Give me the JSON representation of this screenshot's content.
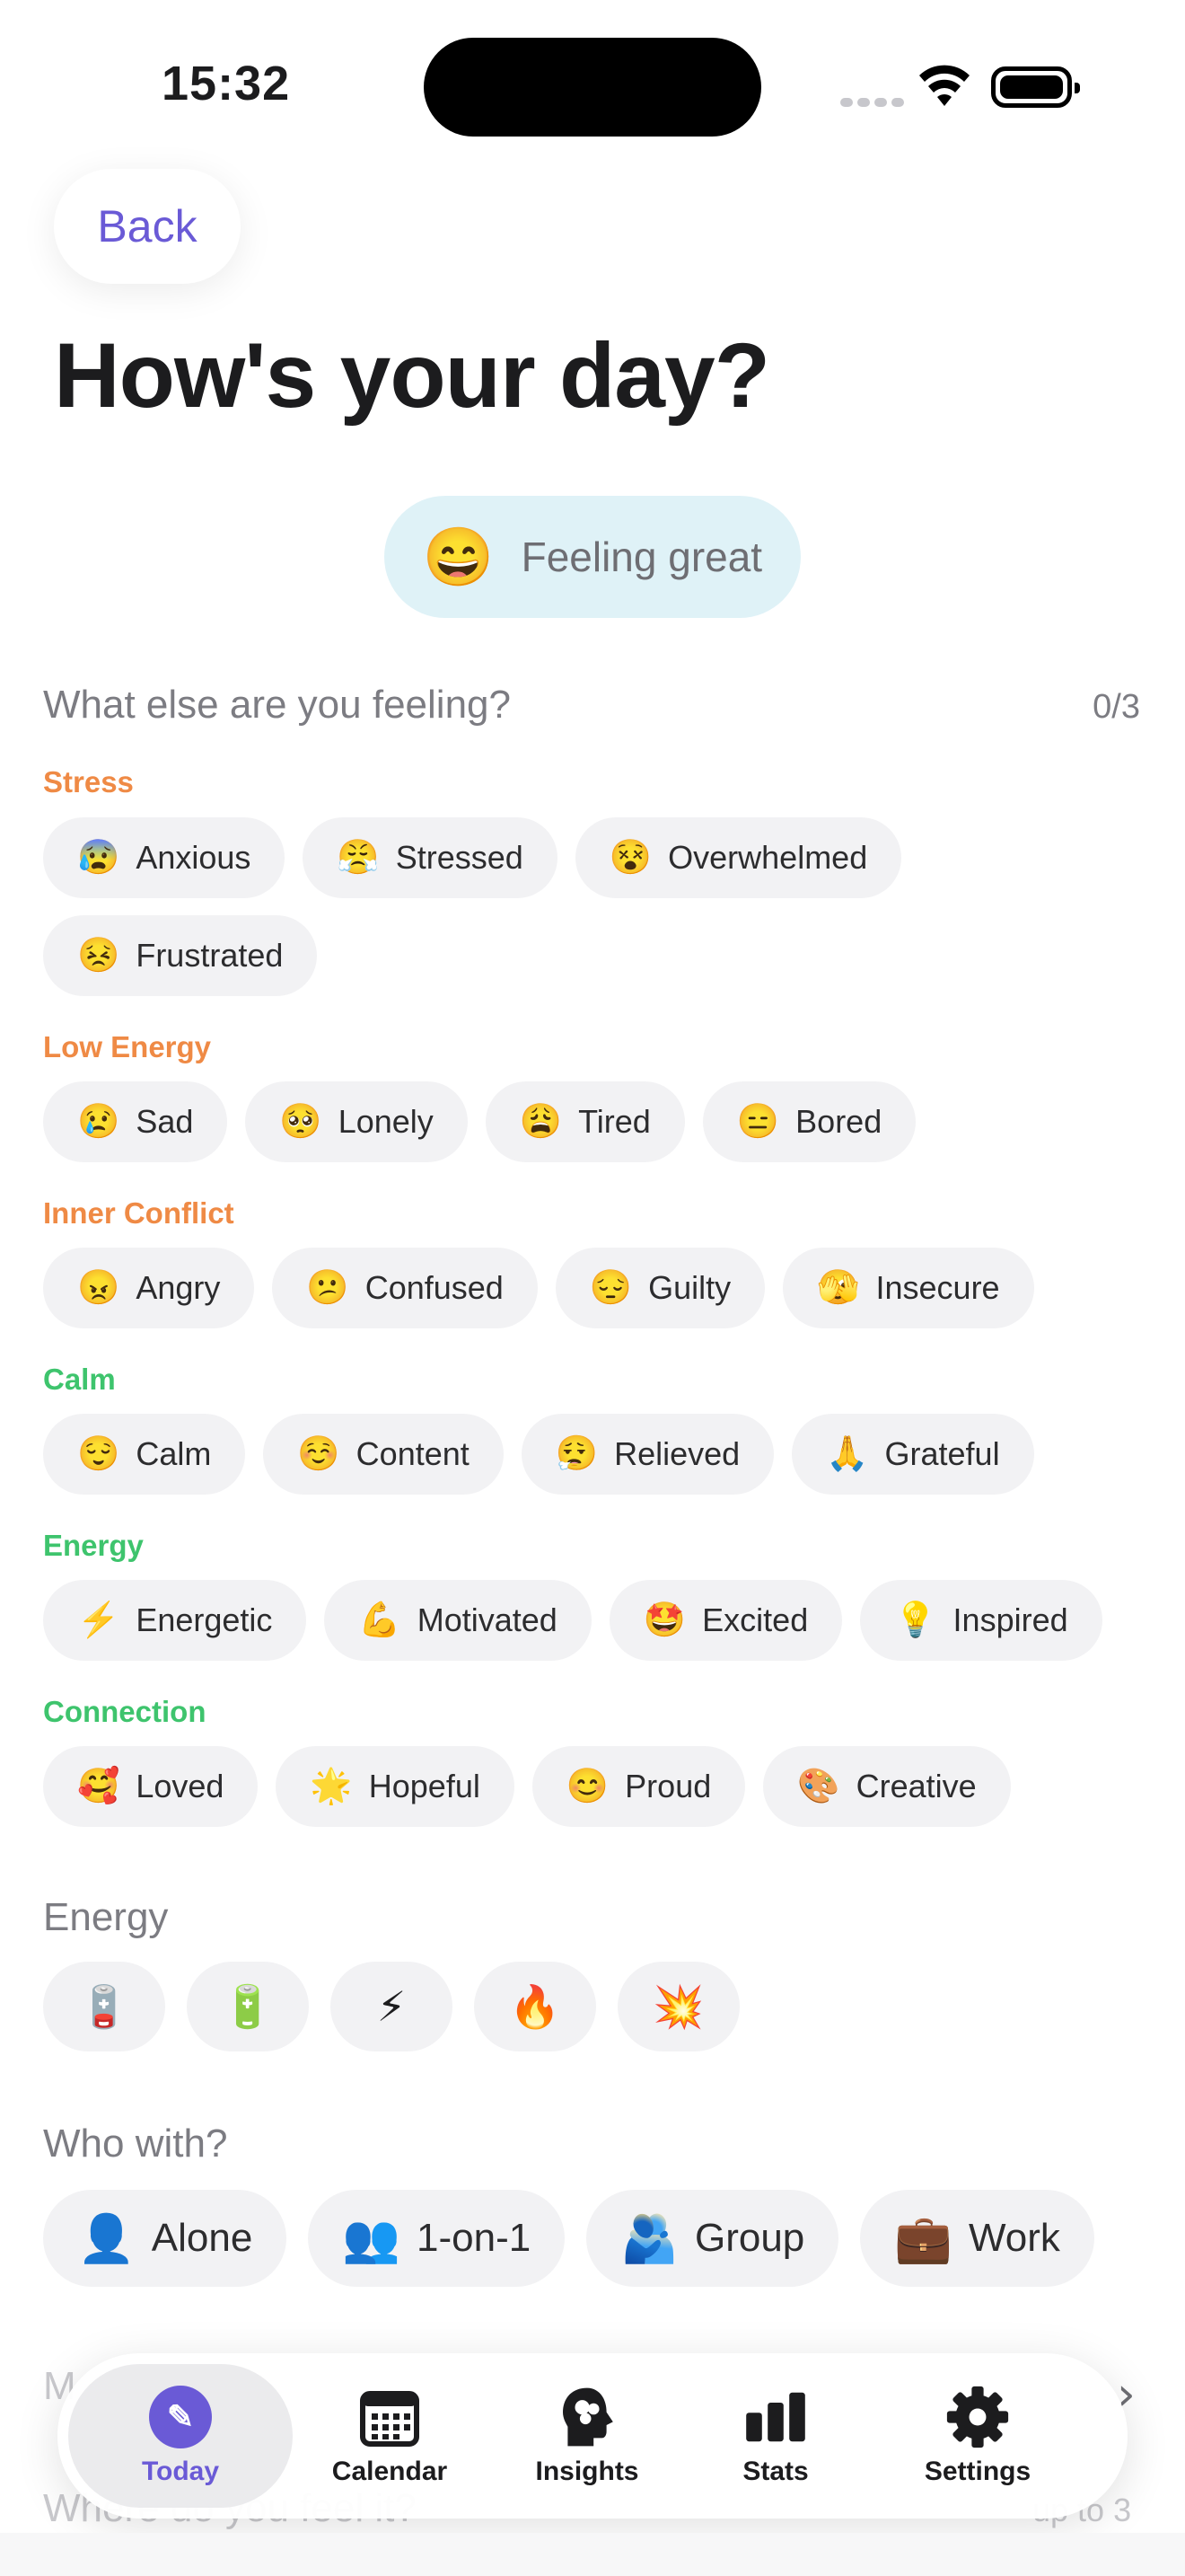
{
  "status_bar": {
    "time": "15:32"
  },
  "header": {
    "back_label": "Back",
    "title": "How's your day?"
  },
  "mood": {
    "emoji": "😄",
    "label": "Feeling great"
  },
  "feelings": {
    "question": "What else are you feeling?",
    "counter": "0/3",
    "groups": [
      {
        "title": "Stress",
        "color": "#ef8a45",
        "items": [
          {
            "emoji": "😰",
            "label": "Anxious"
          },
          {
            "emoji": "😤",
            "label": "Stressed"
          },
          {
            "emoji": "😵",
            "label": "Overwhelmed"
          },
          {
            "emoji": "😣",
            "label": "Frustrated"
          }
        ]
      },
      {
        "title": "Low Energy",
        "color": "#ef8a45",
        "items": [
          {
            "emoji": "😢",
            "label": "Sad"
          },
          {
            "emoji": "🥺",
            "label": "Lonely"
          },
          {
            "emoji": "😩",
            "label": "Tired"
          },
          {
            "emoji": "😑",
            "label": "Bored"
          }
        ]
      },
      {
        "title": "Inner Conflict",
        "color": "#ef8a45",
        "items": [
          {
            "emoji": "😠",
            "label": "Angry"
          },
          {
            "emoji": "😕",
            "label": "Confused"
          },
          {
            "emoji": "😔",
            "label": "Guilty"
          },
          {
            "emoji": "🫣",
            "label": "Insecure"
          }
        ]
      },
      {
        "title": "Calm",
        "color": "#3ec46d",
        "items": [
          {
            "emoji": "😌",
            "label": "Calm"
          },
          {
            "emoji": "☺️",
            "label": "Content"
          },
          {
            "emoji": "😮‍💨",
            "label": "Relieved"
          },
          {
            "emoji": "🙏",
            "label": "Grateful"
          }
        ]
      },
      {
        "title": "Energy",
        "color": "#3ec46d",
        "items": [
          {
            "emoji": "⚡",
            "label": "Energetic"
          },
          {
            "emoji": "💪",
            "label": "Motivated"
          },
          {
            "emoji": "🤩",
            "label": "Excited"
          },
          {
            "emoji": "💡",
            "label": "Inspired"
          }
        ]
      },
      {
        "title": "Connection",
        "color": "#3ec46d",
        "items": [
          {
            "emoji": "🥰",
            "label": "Loved"
          },
          {
            "emoji": "🌟",
            "label": "Hopeful"
          },
          {
            "emoji": "😊",
            "label": "Proud"
          },
          {
            "emoji": "🎨",
            "label": "Creative"
          }
        ]
      }
    ]
  },
  "energy": {
    "title": "Energy",
    "levels": [
      "🪫",
      "🔋",
      "⚡",
      "🔥",
      "💥"
    ]
  },
  "who_with": {
    "title": "Who with?",
    "options": [
      {
        "emoji": "👤",
        "label": "Alone"
      },
      {
        "emoji": "👥",
        "label": "1-on-1"
      },
      {
        "emoji": "🫂",
        "label": "Group"
      },
      {
        "emoji": "💼",
        "label": "Work"
      }
    ]
  },
  "partially_hidden": {
    "next_title_fragment": "M",
    "where_label": "Where do you feel it?",
    "limit": "up to 3"
  },
  "tabbar": {
    "tabs": [
      {
        "label": "Today",
        "icon": "pencil-icon",
        "active": true
      },
      {
        "label": "Calendar",
        "icon": "calendar-icon",
        "active": false
      },
      {
        "label": "Insights",
        "icon": "brain-head-icon",
        "active": false
      },
      {
        "label": "Stats",
        "icon": "bar-chart-icon",
        "active": false
      },
      {
        "label": "Settings",
        "icon": "gear-icon",
        "active": false
      }
    ]
  },
  "colors": {
    "accent": "#6a5ad6",
    "orange": "#ef8a45",
    "green": "#3ec46d",
    "mood_pill": "#dff2f7"
  }
}
